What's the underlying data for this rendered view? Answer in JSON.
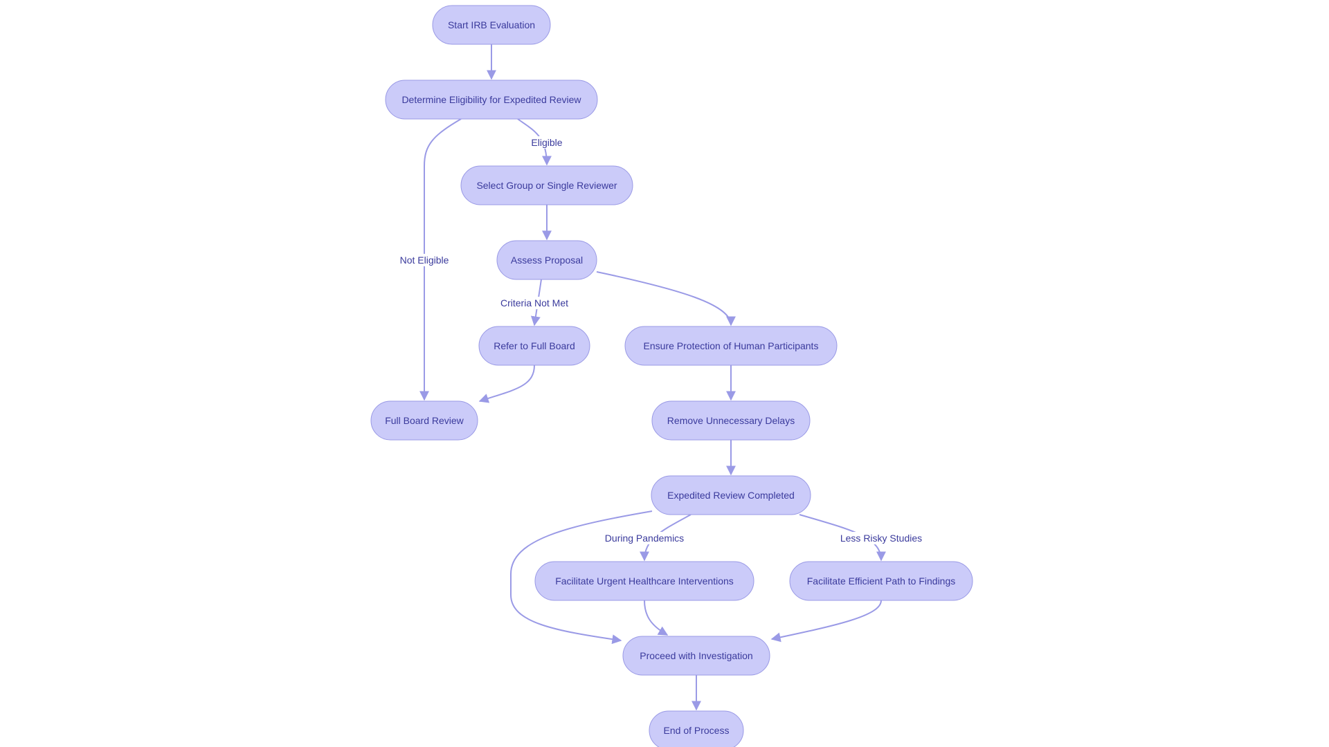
{
  "diagram": {
    "type": "flowchart",
    "colors": {
      "node_fill": "#cbcbf9",
      "node_stroke": "#9999e5",
      "edge": "#9a9ae6",
      "text": "#3a3a9c"
    },
    "nodes": [
      {
        "id": "start",
        "label": "Start IRB Evaluation"
      },
      {
        "id": "eligibility",
        "label": "Determine Eligibility for Expedited Review"
      },
      {
        "id": "select",
        "label": "Select Group or Single Reviewer"
      },
      {
        "id": "assess",
        "label": "Assess Proposal"
      },
      {
        "id": "refer",
        "label": "Refer to Full Board"
      },
      {
        "id": "protect",
        "label": "Ensure Protection of Human Participants"
      },
      {
        "id": "fullboard",
        "label": "Full Board Review"
      },
      {
        "id": "delays",
        "label": "Remove Unnecessary Delays"
      },
      {
        "id": "completed",
        "label": "Expedited Review Completed"
      },
      {
        "id": "urgent",
        "label": "Facilitate Urgent Healthcare Interventions"
      },
      {
        "id": "efficient",
        "label": "Facilitate Efficient Path to Findings"
      },
      {
        "id": "proceed",
        "label": "Proceed with Investigation"
      },
      {
        "id": "end",
        "label": "End of Process"
      }
    ],
    "edges": [
      {
        "from": "start",
        "to": "eligibility",
        "label": ""
      },
      {
        "from": "eligibility",
        "to": "select",
        "label": "Eligible"
      },
      {
        "from": "eligibility",
        "to": "fullboard",
        "label": "Not Eligible"
      },
      {
        "from": "select",
        "to": "assess",
        "label": ""
      },
      {
        "from": "assess",
        "to": "refer",
        "label": "Criteria Not Met"
      },
      {
        "from": "assess",
        "to": "protect",
        "label": ""
      },
      {
        "from": "refer",
        "to": "fullboard",
        "label": ""
      },
      {
        "from": "protect",
        "to": "delays",
        "label": ""
      },
      {
        "from": "delays",
        "to": "completed",
        "label": ""
      },
      {
        "from": "completed",
        "to": "urgent",
        "label": "During Pandemics"
      },
      {
        "from": "completed",
        "to": "efficient",
        "label": "Less Risky Studies"
      },
      {
        "from": "completed",
        "to": "proceed",
        "label": ""
      },
      {
        "from": "urgent",
        "to": "proceed",
        "label": ""
      },
      {
        "from": "efficient",
        "to": "proceed",
        "label": ""
      },
      {
        "from": "proceed",
        "to": "end",
        "label": ""
      }
    ]
  }
}
